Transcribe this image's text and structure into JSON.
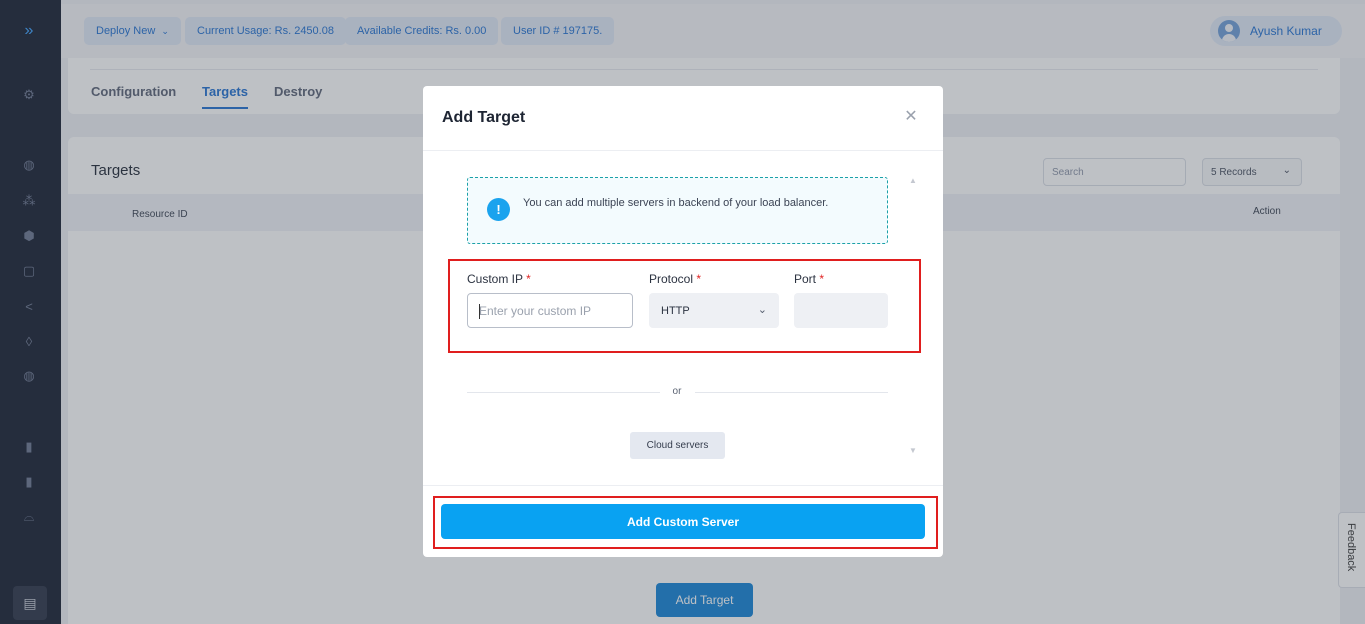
{
  "sidebar": {
    "toggle_icon": "double-chevron-right-icon",
    "items": [
      {
        "icon": "rocket-icon"
      },
      {
        "icon": "globe-icon"
      },
      {
        "icon": "network-icon"
      },
      {
        "icon": "box-icon"
      },
      {
        "icon": "lock-icon"
      },
      {
        "icon": "share-icon"
      },
      {
        "icon": "shield-icon"
      },
      {
        "icon": "globe-alt-icon"
      },
      {
        "icon": "documents-icon"
      },
      {
        "icon": "storage-icon"
      },
      {
        "icon": "cloud-icon"
      }
    ],
    "bottom_icon": "document-icon"
  },
  "topbar": {
    "deploy_label": "Deploy New",
    "usage_label": "Current Usage: Rs. 2450.08",
    "credits_label": "Available Credits: Rs. 0.00",
    "user_id_label": "User ID # 197175.",
    "user_name": "Ayush Kumar"
  },
  "tabs": [
    {
      "label": "Configuration",
      "active": false
    },
    {
      "label": "Targets",
      "active": true
    },
    {
      "label": "Destroy",
      "active": false
    }
  ],
  "targets": {
    "title": "Targets",
    "search_placeholder": "Search",
    "records_value": "5 Records",
    "columns": [
      "Resource ID",
      "Action"
    ],
    "add_target_label": "Add Target"
  },
  "feedback_label": "Feedback",
  "modal": {
    "title": "Add Target",
    "info_text": "You can add multiple servers in backend of your load balancer.",
    "custom_ip_label": "Custom IP",
    "protocol_label": "Protocol",
    "port_label": "Port",
    "required_marker": "*",
    "custom_ip_placeholder": "Enter your custom IP",
    "protocol_value": "HTTP",
    "port_value": "",
    "or_label": "or",
    "cloud_servers_label": "Cloud servers",
    "add_custom_server_label": "Add Custom Server"
  },
  "colors": {
    "accent": "#1f6fd1",
    "primary_button": "#09a2f2",
    "highlight_box": "#e01e1e",
    "sidebar_bg": "#151d2e"
  }
}
